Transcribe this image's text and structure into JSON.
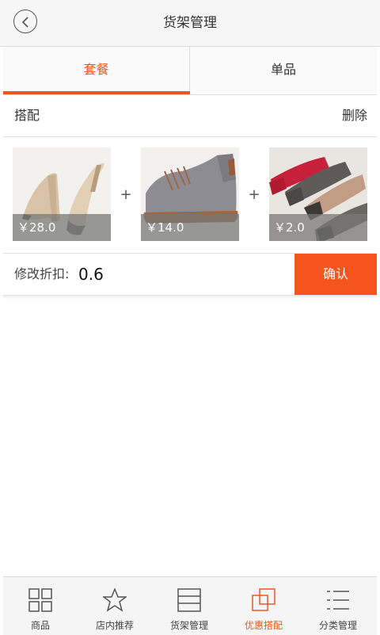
{
  "header": {
    "title": "货架管理"
  },
  "tabs": [
    {
      "label": "套餐",
      "active": true
    },
    {
      "label": "单品",
      "active": false
    }
  ],
  "combo": {
    "label": "搭配",
    "delete_label": "删除"
  },
  "products": [
    {
      "price": "￥28.0",
      "name": "nude-pointed-heels"
    },
    {
      "price": "￥14.0",
      "name": "gray-suede-oxford"
    },
    {
      "price": "￥2.0",
      "name": "bow-flat-shoes"
    }
  ],
  "plus_sign": "+",
  "discount": {
    "label": "修改折扣:",
    "value": "0.6",
    "confirm_label": "确认"
  },
  "bottom_nav": [
    {
      "label": "商品",
      "icon": "grid-icon",
      "active": false
    },
    {
      "label": "店内推荐",
      "icon": "star-icon",
      "active": false
    },
    {
      "label": "货架管理",
      "icon": "shelf-icon",
      "active": false
    },
    {
      "label": "优惠搭配",
      "icon": "overlap-squares-icon",
      "active": true
    },
    {
      "label": "分类管理",
      "icon": "list-icon",
      "active": false
    }
  ],
  "colors": {
    "accent": "#f5541e",
    "header_bg": "#f6f6f6",
    "nav_bg": "#f5f5f5"
  }
}
